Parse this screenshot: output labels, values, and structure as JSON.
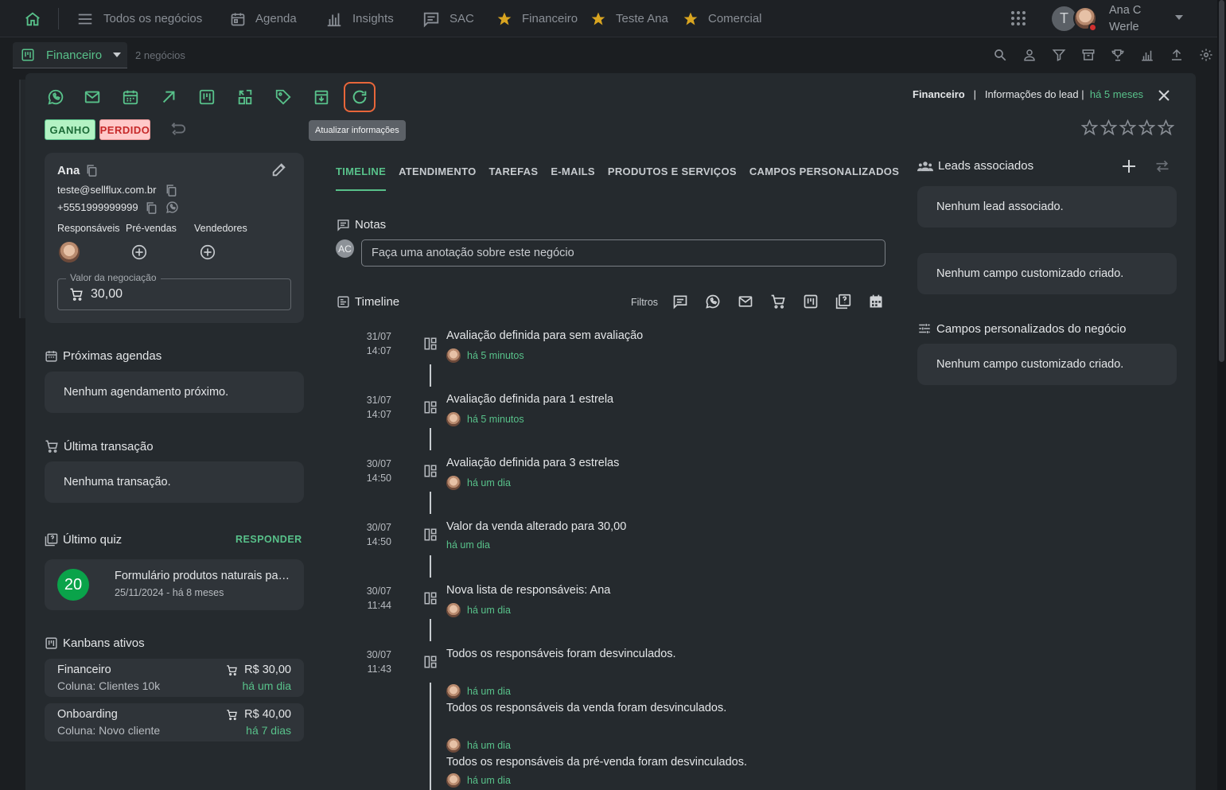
{
  "topnav": {
    "items": [
      {
        "label": "Todos os negócios",
        "icon": "list-icon"
      },
      {
        "label": "Agenda",
        "icon": "calendar-icon"
      },
      {
        "label": "Insights",
        "icon": "bar-chart-icon"
      },
      {
        "label": "SAC",
        "icon": "chat-icon"
      },
      {
        "label": "Financeiro",
        "icon": "star-icon"
      },
      {
        "label": "Teste Ana",
        "icon": "star-icon"
      },
      {
        "label": "Comercial",
        "icon": "star-icon"
      }
    ],
    "user": {
      "initial": "T",
      "name": "Ana C Werle"
    }
  },
  "subbar": {
    "pipeline": "Financeiro",
    "count": "2 negócios"
  },
  "modal": {
    "tooltip": "Atualizar informações",
    "badges": {
      "won": "GANHO",
      "lost": "PERDIDO"
    },
    "header": {
      "pipeline": "Financeiro",
      "sep": "|",
      "info": "Informações do lead |",
      "time": "há 5 meses"
    },
    "lead": {
      "name": "Ana",
      "email": "teste@sellflux.com.br",
      "phone": "+5551999999999",
      "roles": {
        "owners": "Responsáveis",
        "presales": "Pré-vendas",
        "sellers": "Vendedores"
      },
      "value_label": "Valor da negociação",
      "value": "30,00"
    },
    "next_schedules": {
      "title": "Próximas agendas",
      "empty": "Nenhum agendamento próximo."
    },
    "last_transaction": {
      "title": "Última transação",
      "empty": "Nenhuma transação."
    },
    "last_quiz": {
      "title": "Último quiz",
      "action": "RESPONDER",
      "score": "20",
      "name": "Formulário produtos naturais para emagrecimento",
      "date": "25/11/2024 - há 8 meses"
    },
    "kanbans": {
      "title": "Kanbans ativos",
      "items": [
        {
          "name": "Financeiro",
          "column": "Coluna: Clientes 10k",
          "value": "R$ 30,00",
          "time": "há um dia"
        },
        {
          "name": "Onboarding",
          "column": "Coluna: Novo cliente",
          "value": "R$ 40,00",
          "time": "há 7 dias"
        }
      ]
    },
    "tabs": [
      "TIMELINE",
      "ATENDIMENTO",
      "TAREFAS",
      "E-MAILS",
      "PRODUTOS E SERVIÇOS",
      "CAMPOS PERSONALIZADOS"
    ],
    "notes": {
      "title": "Notas",
      "avatar": "AC",
      "placeholder": "Faça uma anotação sobre este negócio"
    },
    "timeline": {
      "title": "Timeline",
      "filters_label": "Filtros",
      "events": [
        {
          "date": "31/07",
          "time": "14:07",
          "text": "Avaliação definida para sem avaliação",
          "ago": "há 5 minutos",
          "avatar": true
        },
        {
          "date": "31/07",
          "time": "14:07",
          "text": "Avaliação definida para 1 estrela",
          "ago": "há 5 minutos",
          "avatar": true
        },
        {
          "date": "30/07",
          "time": "14:50",
          "text": "Avaliação definida para 3 estrelas",
          "ago": "há um dia",
          "avatar": true
        },
        {
          "date": "30/07",
          "time": "14:50",
          "text": "Valor da venda alterado para 30,00",
          "ago": "há um dia",
          "avatar": false
        },
        {
          "date": "30/07",
          "time": "11:44",
          "text": "Nova lista de responsáveis: Ana",
          "ago": "há um dia",
          "avatar": true
        },
        {
          "date": "30/07",
          "time": "11:43",
          "text": "Todos os responsáveis foram desvinculados.",
          "ago": "",
          "avatar": false
        }
      ],
      "sub_events": [
        {
          "ago": "há um dia",
          "text": "Todos os responsáveis da venda foram desvinculados."
        },
        {
          "ago": "há um dia",
          "text": "Todos os responsáveis da pré-venda foram desvinculados."
        },
        {
          "ago": "há um dia",
          "text": ""
        }
      ]
    },
    "right": {
      "leads_title": "Leads associados",
      "leads_empty": "Nenhum lead associado.",
      "custom_empty": "Nenhum campo customizado criado.",
      "deal_fields_title": "Campos personalizados do negócio",
      "deal_fields_empty": "Nenhum campo customizado criado."
    }
  }
}
